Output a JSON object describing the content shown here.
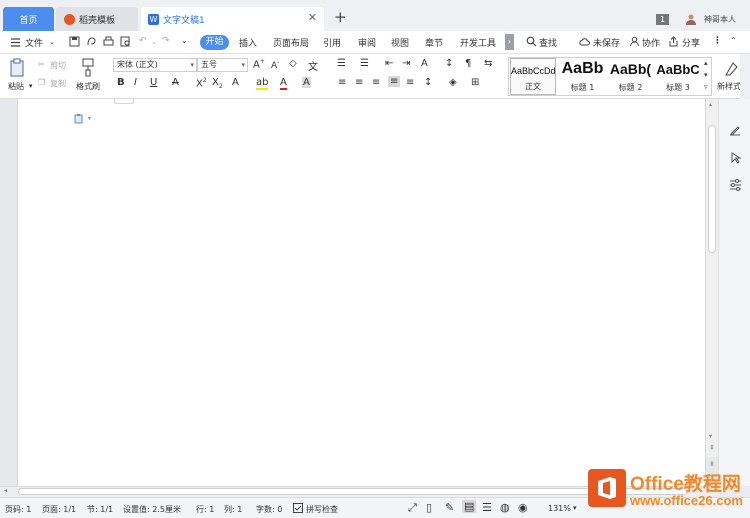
{
  "tabs": {
    "home": "首页",
    "templates": "稻壳模板",
    "document": "文字文稿1",
    "badge": "1",
    "user": "神哥本人"
  },
  "menu": {
    "file": "文件",
    "start": "开始",
    "insert": "插入",
    "layout": "页面布局",
    "references": "引用",
    "review": "审阅",
    "view": "视图",
    "section": "章节",
    "developer": "开发工具",
    "find": "查找",
    "unsaved": "未保存",
    "collaborate": "协作",
    "share": "分享"
  },
  "ribbon": {
    "paste": "粘贴",
    "cut": "剪切",
    "copy": "复制",
    "format_painter": "格式刷",
    "font_name": "宋体 (正文)",
    "font_size": "五号",
    "styles": [
      {
        "sample": "AaBbCcDd",
        "name": "正文"
      },
      {
        "sample": "AaBb",
        "name": "标题 1"
      },
      {
        "sample": "AaBb(",
        "name": "标题 2"
      },
      {
        "sample": "AaBbC",
        "name": "标题 3"
      }
    ],
    "new_style": "新样式"
  },
  "status": {
    "page_no": "页码: 1",
    "pages": "页面: 1/1",
    "section": "节: 1/1",
    "setting": "设置值: 2.5厘米",
    "row": "行: 1",
    "col": "列: 1",
    "word_count": "字数: 0",
    "spell_check": "拼写检查",
    "zoom": "131%"
  },
  "watermark": {
    "title": "Office教程网",
    "url": "www.office26.com"
  },
  "colors": {
    "accent": "#4c8df0",
    "brand_orange": "#e8571f"
  }
}
